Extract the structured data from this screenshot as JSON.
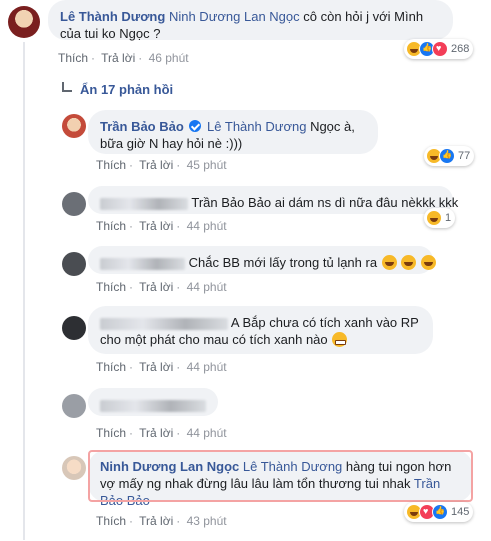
{
  "comments": [
    {
      "name": "Lê Thành Dương",
      "mention": "Ninh Dương Lan Ngọc",
      "text": "cô còn hỏi j với Mình của tui ko Ngọc ?",
      "like": "Thích",
      "reply": "Trả lời",
      "time": "46 phút",
      "reaction_count": "268"
    }
  ],
  "replies_toggle": "Ẩn 17 phản hồi",
  "replies": [
    {
      "name": "Trần Bảo Bảo",
      "mention": "Lê Thành Dương",
      "text": "Ngọc à, bữa giờ N hay hỏi nè :)))",
      "like": "Thích",
      "reply": "Trả lời",
      "time": "45 phút",
      "reaction_count": "77"
    },
    {
      "text": "Trần Bảo Bảo ai dám ns dì nữa đâu nèkkk kkk",
      "like": "Thích",
      "reply": "Trả lời",
      "time": "44 phút",
      "reaction_count": "1"
    },
    {
      "text": "Chắc BB mới lấy trong tủ lạnh ra",
      "like": "Thích",
      "reply": "Trả lời",
      "time": "44 phút"
    },
    {
      "text": "A Bắp chưa có tích xanh vào RP cho một phát cho mau có tích xanh nào",
      "like": "Thích",
      "reply": "Trả lời",
      "time": "44 phút"
    },
    {
      "like": "Thích",
      "reply": "Trả lời",
      "time": "44 phút"
    },
    {
      "name": "Ninh Dương Lan Ngọc",
      "mention": "Lê Thành Dương",
      "text": "hàng tui ngon hơn vợ mấy ng nhak đừng lâu lâu làm tổn thương tui nhak",
      "mention2": "Trần Bảo Bảo",
      "like": "Thích",
      "reply": "Trả lời",
      "time": "43 phút",
      "reaction_count": "145"
    }
  ],
  "colors": {
    "link": "#385898",
    "bubble": "#f0f2f5",
    "highlight": "#f4a3a3"
  }
}
